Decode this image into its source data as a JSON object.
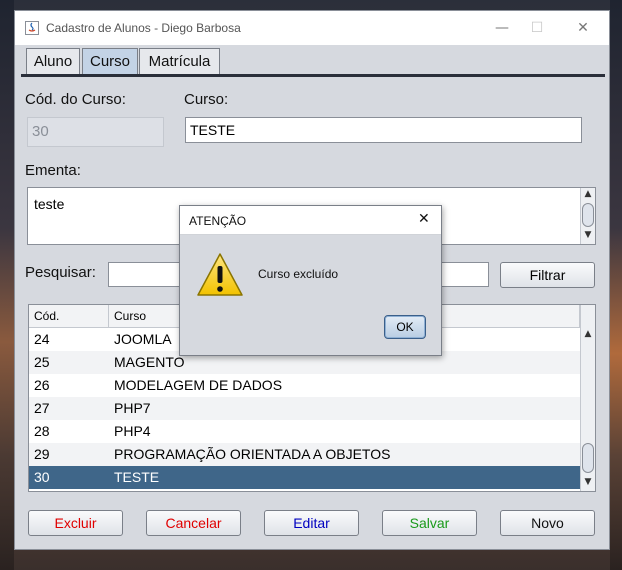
{
  "window": {
    "title": "Cadastro de Alunos - Diego Barbosa",
    "minimize": "—",
    "maximize": "☐",
    "close": "✕"
  },
  "tabs": [
    "Aluno",
    "Curso",
    "Matrícula"
  ],
  "form": {
    "codigo_label": "Cód. do Curso:",
    "codigo_value": "30",
    "curso_label": "Curso:",
    "curso_value": "TESTE",
    "ementa_label": "Ementa:",
    "ementa_value": "teste",
    "pesquisar_label": "Pesquisar:",
    "pesquisar_value": "",
    "filtrar_button": "Filtrar"
  },
  "table": {
    "headers": [
      "Cód.",
      "Curso"
    ],
    "rows": [
      {
        "code": "24",
        "name": "JOOMLA"
      },
      {
        "code": "25",
        "name": "MAGENTO"
      },
      {
        "code": "26",
        "name": "MODELAGEM DE DADOS"
      },
      {
        "code": "27",
        "name": "PHP7"
      },
      {
        "code": "28",
        "name": "PHP4"
      },
      {
        "code": "29",
        "name": "PROGRAMAÇÃO ORIENTADA A OBJETOS"
      },
      {
        "code": "30",
        "name": "TESTE"
      }
    ],
    "selected_code": "30"
  },
  "buttons": {
    "excluir": "Excluir",
    "cancelar": "Cancelar",
    "editar": "Editar",
    "salvar": "Salvar",
    "novo": "Novo"
  },
  "dialog": {
    "title": "ATENÇÃO",
    "message": "Curso excluído",
    "ok": "OK",
    "icon": "warning-icon",
    "close": "✕"
  },
  "colors": {
    "excluir": "#e00000",
    "cancelar": "#e00000",
    "editar": "#0000c0",
    "salvar": "#1a9a1a",
    "novo": "#111111",
    "selected_row": "#3f6689"
  }
}
